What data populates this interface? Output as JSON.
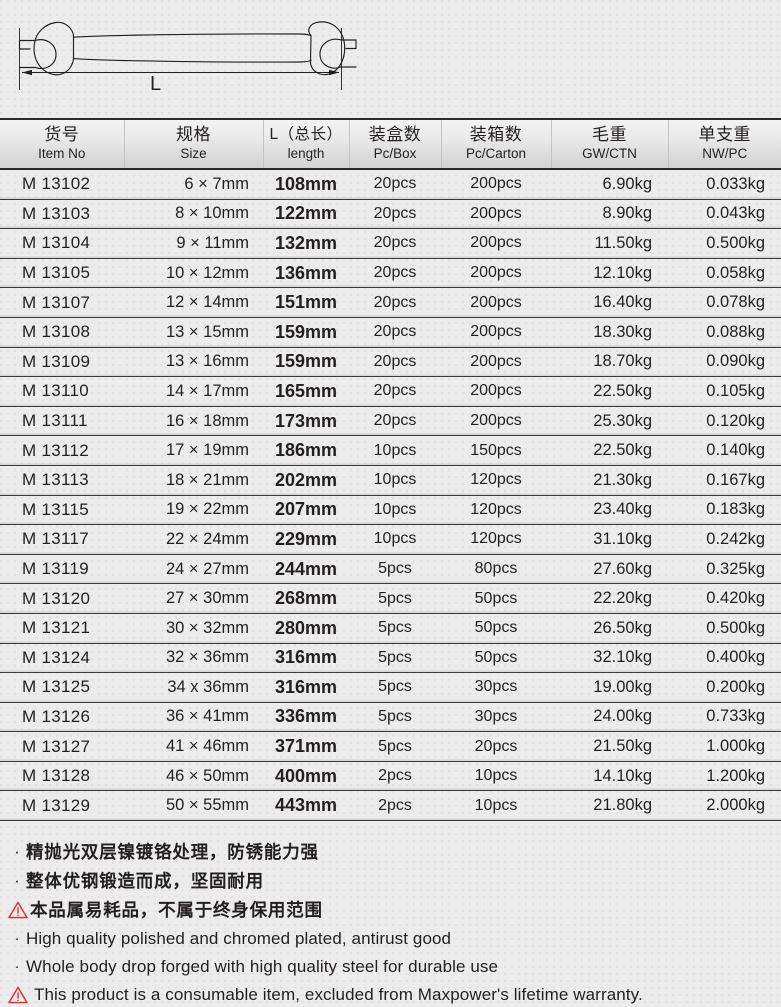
{
  "diagram": {
    "dimension_label": "L",
    "icon": "open-end-wrench-outline"
  },
  "table": {
    "columns": [
      {
        "cn": "货号",
        "en": "Item No",
        "key": "item"
      },
      {
        "cn": "规格",
        "en": "Size",
        "key": "size"
      },
      {
        "cn": "L（总长）",
        "en": "length",
        "key": "len"
      },
      {
        "cn": "装盒数",
        "en": "Pc/Box",
        "key": "box"
      },
      {
        "cn": "装箱数",
        "en": "Pc/Carton",
        "key": "carton"
      },
      {
        "cn": "毛重",
        "en": "GW/CTN",
        "key": "gw"
      },
      {
        "cn": "单支重",
        "en": "NW/PC",
        "key": "nw"
      }
    ],
    "rows": [
      {
        "item": "M 13102",
        "size": "6 × 7mm",
        "len": "108mm",
        "box": "20pcs",
        "carton": "200pcs",
        "gw": "6.90kg",
        "nw": "0.033kg"
      },
      {
        "item": "M 13103",
        "size": "8 × 10mm",
        "len": "122mm",
        "box": "20pcs",
        "carton": "200pcs",
        "gw": "8.90kg",
        "nw": "0.043kg"
      },
      {
        "item": "M 13104",
        "size": "9 × 11mm",
        "len": "132mm",
        "box": "20pcs",
        "carton": "200pcs",
        "gw": "11.50kg",
        "nw": "0.500kg"
      },
      {
        "item": "M 13105",
        "size": "10 × 12mm",
        "len": "136mm",
        "box": "20pcs",
        "carton": "200pcs",
        "gw": "12.10kg",
        "nw": "0.058kg"
      },
      {
        "item": "M 13107",
        "size": "12 × 14mm",
        "len": "151mm",
        "box": "20pcs",
        "carton": "200pcs",
        "gw": "16.40kg",
        "nw": "0.078kg"
      },
      {
        "item": "M 13108",
        "size": "13 × 15mm",
        "len": "159mm",
        "box": "20pcs",
        "carton": "200pcs",
        "gw": "18.30kg",
        "nw": "0.088kg"
      },
      {
        "item": "M 13109",
        "size": "13 × 16mm",
        "len": "159mm",
        "box": "20pcs",
        "carton": "200pcs",
        "gw": "18.70kg",
        "nw": "0.090kg"
      },
      {
        "item": "M 13110",
        "size": "14 × 17mm",
        "len": "165mm",
        "box": "20pcs",
        "carton": "200pcs",
        "gw": "22.50kg",
        "nw": "0.105kg"
      },
      {
        "item": "M 13111",
        "size": "16 × 18mm",
        "len": "173mm",
        "box": "20pcs",
        "carton": "200pcs",
        "gw": "25.30kg",
        "nw": "0.120kg"
      },
      {
        "item": "M 13112",
        "size": "17 × 19mm",
        "len": "186mm",
        "box": "10pcs",
        "carton": "150pcs",
        "gw": "22.50kg",
        "nw": "0.140kg"
      },
      {
        "item": "M 13113",
        "size": "18 × 21mm",
        "len": "202mm",
        "box": "10pcs",
        "carton": "120pcs",
        "gw": "21.30kg",
        "nw": "0.167kg"
      },
      {
        "item": "M 13115",
        "size": "19 × 22mm",
        "len": "207mm",
        "box": "10pcs",
        "carton": "120pcs",
        "gw": "23.40kg",
        "nw": "0.183kg"
      },
      {
        "item": "M 13117",
        "size": "22 × 24mm",
        "len": "229mm",
        "box": "10pcs",
        "carton": "120pcs",
        "gw": "31.10kg",
        "nw": "0.242kg"
      },
      {
        "item": "M 13119",
        "size": "24 × 27mm",
        "len": "244mm",
        "box": "5pcs",
        "carton": "80pcs",
        "gw": "27.60kg",
        "nw": "0.325kg"
      },
      {
        "item": "M 13120",
        "size": "27 × 30mm",
        "len": "268mm",
        "box": "5pcs",
        "carton": "50pcs",
        "gw": "22.20kg",
        "nw": "0.420kg"
      },
      {
        "item": "M 13121",
        "size": "30 × 32mm",
        "len": "280mm",
        "box": "5pcs",
        "carton": "50pcs",
        "gw": "26.50kg",
        "nw": "0.500kg"
      },
      {
        "item": "M 13124",
        "size": "32 × 36mm",
        "len": "316mm",
        "box": "5pcs",
        "carton": "50pcs",
        "gw": "32.10kg",
        "nw": "0.400kg"
      },
      {
        "item": "M 13125",
        "size": "34 x 36mm",
        "len": "316mm",
        "box": "5pcs",
        "carton": "30pcs",
        "gw": "19.00kg",
        "nw": "0.200kg"
      },
      {
        "item": "M 13126",
        "size": "36 × 41mm",
        "len": "336mm",
        "box": "5pcs",
        "carton": "30pcs",
        "gw": "24.00kg",
        "nw": "0.733kg"
      },
      {
        "item": "M 13127",
        "size": "41 × 46mm",
        "len": "371mm",
        "box": "5pcs",
        "carton": "20pcs",
        "gw": "21.50kg",
        "nw": "1.000kg"
      },
      {
        "item": "M 13128",
        "size": "46 × 50mm",
        "len": "400mm",
        "box": "2pcs",
        "carton": "10pcs",
        "gw": "14.10kg",
        "nw": "1.200kg"
      },
      {
        "item": "M 13129",
        "size": "50 × 55mm",
        "len": "443mm",
        "box": "2pcs",
        "carton": "10pcs",
        "gw": "21.80kg",
        "nw": "2.000kg"
      }
    ]
  },
  "notes": [
    {
      "marker": "·",
      "marker_type": "bullet",
      "text": "精抛光双层镍镀铬处理，防锈能力强",
      "lang": "cn"
    },
    {
      "marker": "·",
      "marker_type": "bullet",
      "text": "整体优钢锻造而成，坚固耐用",
      "lang": "cn"
    },
    {
      "marker": "",
      "marker_type": "warning",
      "text": "本品属易耗品，不属于终身保用范围",
      "lang": "cn"
    },
    {
      "marker": "·",
      "marker_type": "bullet",
      "text": "High quality polished and chromed plated, antirust good",
      "lang": "en"
    },
    {
      "marker": "·",
      "marker_type": "bullet",
      "text": "Whole body drop forged with high quality steel for durable use",
      "lang": "en"
    },
    {
      "marker": "",
      "marker_type": "warning",
      "text": "This product is a consumable item, excluded from Maxpower's lifetime warranty.",
      "lang": "en"
    }
  ],
  "colors": {
    "warning_red": "#e8262d",
    "text": "#231f20",
    "rule_dark": "#3a3a3a",
    "rule_light": "#d6d6d6"
  }
}
